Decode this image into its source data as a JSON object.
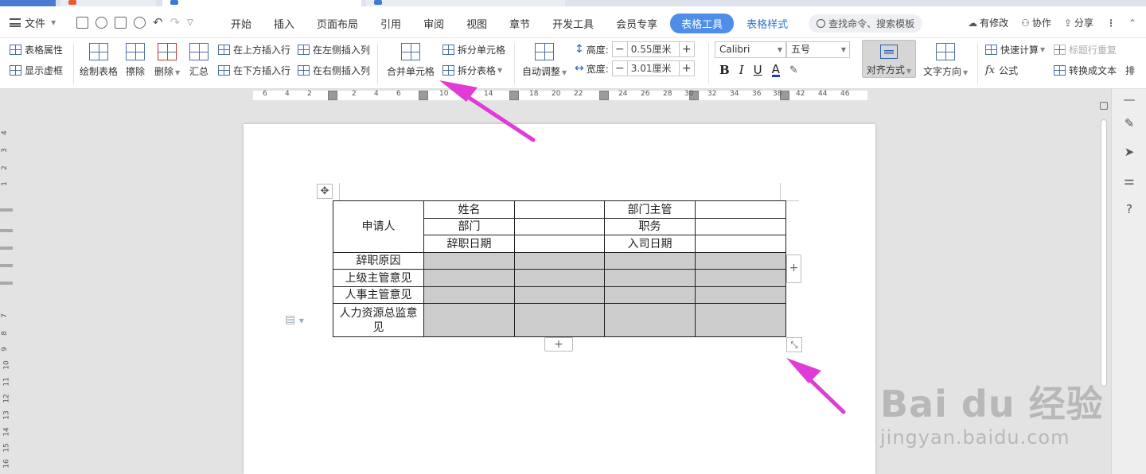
{
  "menu": {
    "file_label": "文件",
    "tabs": [
      "开始",
      "插入",
      "页面布局",
      "引用",
      "审阅",
      "视图",
      "章节",
      "开发工具",
      "会员专享",
      "表格工具",
      "表格样式"
    ],
    "active_tab": "表格工具",
    "search_label": "查找命令、搜索模板",
    "right": {
      "modified": "有修改",
      "collab": "协作",
      "share": "分享"
    }
  },
  "ribbon": {
    "table_props": "表格属性",
    "show_gridlines": "显示虚框",
    "draw_table": "绘制表格",
    "erase": "擦除",
    "delete": "删除",
    "summary": "汇总",
    "insert_above": "在上方插入行",
    "insert_below": "在下方插入行",
    "insert_left": "在左侧插入列",
    "insert_right": "在右侧插入列",
    "merge_cells": "合并单元格",
    "split_cells": "拆分单元格",
    "split_table": "拆分表格",
    "auto_fit": "自动调整",
    "height_label": "高度:",
    "height_value": "0.55厘米",
    "width_label": "宽度:",
    "width_value": "3.01厘米",
    "font_name": "Calibri",
    "font_size": "五号",
    "align": "对齐方式",
    "text_direction": "文字方向",
    "quick_calc": "快速计算",
    "formula": "公式",
    "header_repeat": "标题行重复",
    "convert_text": "转换成文本",
    "sort_partial": "排"
  },
  "ruler": {
    "h_numbers": [
      "6",
      "4",
      "2",
      "2",
      "4",
      "6",
      "10",
      "14",
      "18",
      "20",
      "22",
      "24",
      "26",
      "28",
      "30",
      "32",
      "34",
      "36",
      "38",
      "40",
      "42",
      "44",
      "46"
    ],
    "v_numbers": [
      "4",
      "3",
      "2",
      "1",
      "7",
      "8",
      "9",
      "10",
      "11",
      "12",
      "13",
      "14",
      "15",
      "16"
    ]
  },
  "table": {
    "applicant": "申请人",
    "name": "姓名",
    "dept_head": "部门主管",
    "dept": "部门",
    "position": "职务",
    "resign_date": "辞职日期",
    "join_date": "入司日期",
    "reason": "辞职原因",
    "supervisor_opinion": "上级主管意见",
    "hr_opinion": "人事主管意见",
    "hr_director_opinion": "人力资源总监意见"
  },
  "watermark": {
    "brand": "Bai du 经验",
    "url": "jingyan.baidu.com"
  },
  "colors": {
    "accent": "#4f8ee8",
    "arrow": "#e03bd6",
    "shade": "#cccccc"
  }
}
